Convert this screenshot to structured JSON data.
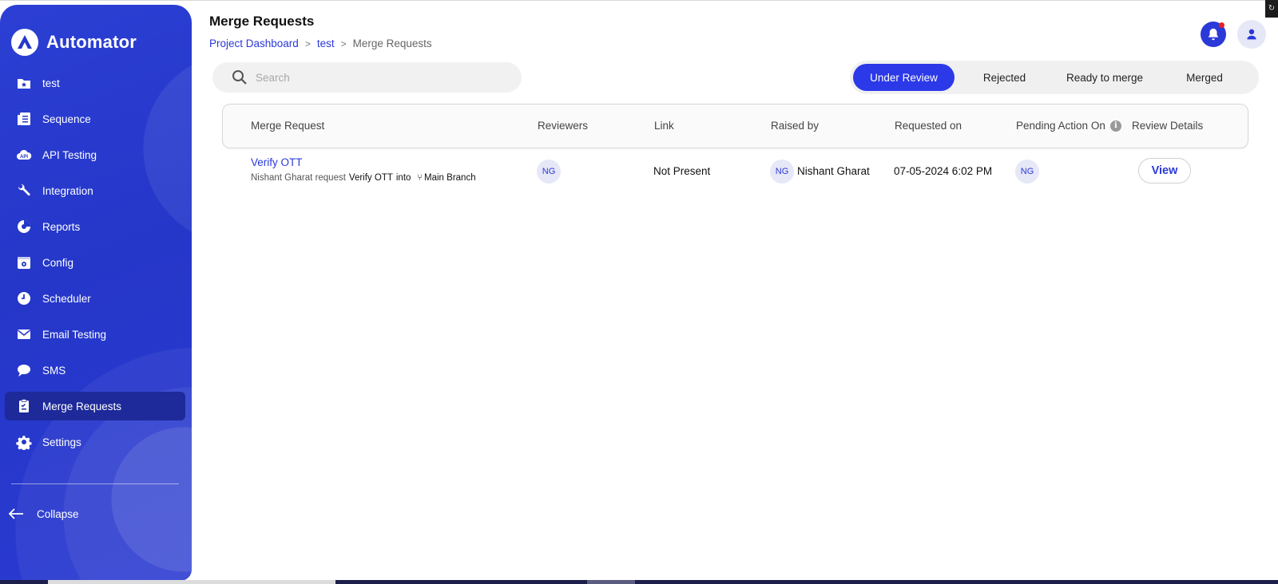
{
  "app": {
    "name": "Automator"
  },
  "colors": {
    "primary": "#2b39d8",
    "sidebar": "#2537c9",
    "active_tab": "#2b39e8",
    "notification_dot": "#e62222"
  },
  "sidebar": {
    "items": [
      {
        "label": "test",
        "icon": "folder-star-icon"
      },
      {
        "label": "Sequence",
        "icon": "list-document-icon"
      },
      {
        "label": "API Testing",
        "icon": "cloud-api-icon"
      },
      {
        "label": "Integration",
        "icon": "wrench-icon"
      },
      {
        "label": "Reports",
        "icon": "pie-chart-icon"
      },
      {
        "label": "Config",
        "icon": "config-calendar-icon"
      },
      {
        "label": "Scheduler",
        "icon": "clock-icon"
      },
      {
        "label": "Email Testing",
        "icon": "envelope-icon"
      },
      {
        "label": "SMS",
        "icon": "chat-bubble-icon"
      },
      {
        "label": "Merge Requests",
        "icon": "clipboard-icon",
        "active": true
      },
      {
        "label": "Settings",
        "icon": "gear-icon"
      }
    ],
    "collapse_label": "Collapse"
  },
  "header": {
    "title": "Merge Requests",
    "breadcrumb": {
      "home": "Project Dashboard",
      "project": "test",
      "current": "Merge Requests",
      "separator": ">"
    }
  },
  "search": {
    "placeholder": "Search",
    "value": ""
  },
  "tabs": [
    {
      "label": "Under Review",
      "active": true
    },
    {
      "label": "Rejected"
    },
    {
      "label": "Ready to merge"
    },
    {
      "label": "Merged"
    }
  ],
  "table": {
    "columns": [
      "Merge Request",
      "Reviewers",
      "Link",
      "Raised by",
      "Requested on",
      "Pending Action On",
      "Review Details"
    ],
    "info_icon_glyph": "i",
    "rows": [
      {
        "title": "Verify OTT",
        "requester": "Nishant Gharat",
        "request_word": "request",
        "name": "Verify OTT",
        "into_word": "into",
        "branch": "Main Branch",
        "reviewer_initials": "NG",
        "link": "Not Present",
        "raised_by_initials": "NG",
        "raised_by": "Nishant Gharat",
        "requested_on": "07-05-2024 6:02 PM",
        "pending_initials": "NG",
        "action_label": "View"
      }
    ]
  }
}
